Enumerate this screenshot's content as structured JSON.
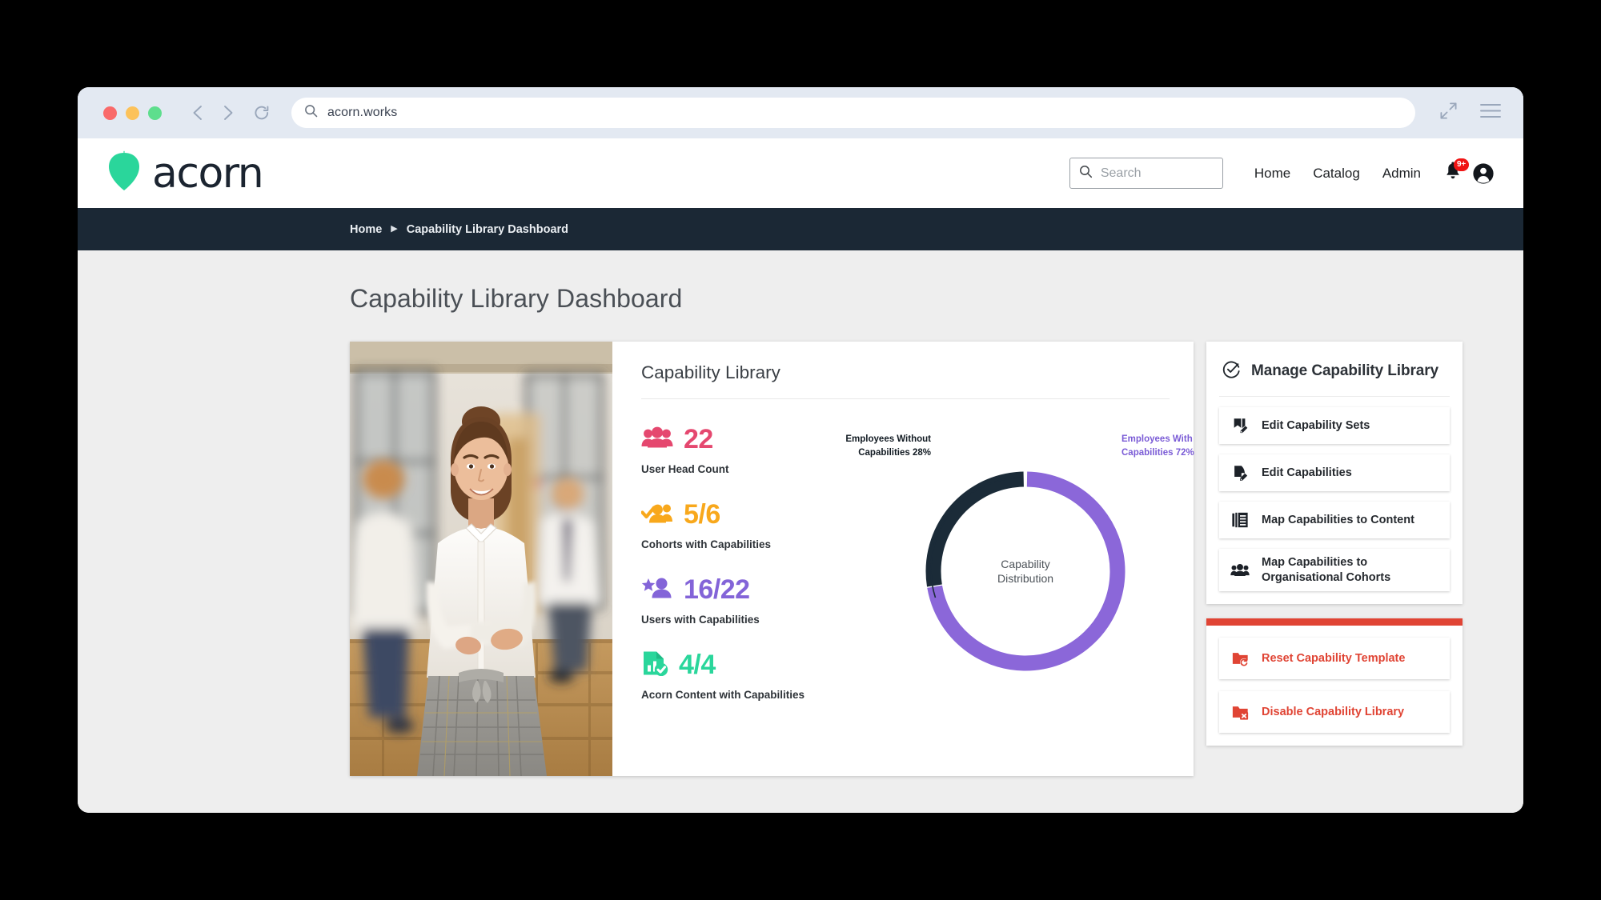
{
  "browser": {
    "url": "acorn.works",
    "back_icon": "chevron-left-icon",
    "forward_icon": "chevron-right-icon",
    "reload_icon": "reload-icon",
    "search_icon": "search-icon",
    "expand_icon": "expand-arrows-icon",
    "menu_icon": "hamburger-menu-icon"
  },
  "header": {
    "logo_text": "acorn",
    "logo_icon": "acorn-leaf-icon",
    "search": {
      "placeholder": "Search",
      "value": "",
      "icon": "search-icon"
    },
    "nav": [
      {
        "label": "Home"
      },
      {
        "label": "Catalog"
      },
      {
        "label": "Admin"
      }
    ],
    "bell_icon": "bell-icon",
    "bell_badge": "9+",
    "avatar_icon": "user-avatar-icon"
  },
  "breadcrumb": {
    "items": [
      {
        "label": "Home"
      },
      {
        "label": "Capability Library Dashboard"
      }
    ],
    "separator": "▶"
  },
  "page": {
    "title": "Capability Library Dashboard"
  },
  "main_card": {
    "title": "Capability Library",
    "photo_alt": "smiling-woman-in-office-photo",
    "stats": [
      {
        "value": "22",
        "label": "User Head Count",
        "icon": "people-group-icon",
        "color": "#e5486f"
      },
      {
        "value": "5/6",
        "label": "Cohorts with Capabilities",
        "icon": "people-check-icon",
        "color": "#f8a81c"
      },
      {
        "value": "16/22",
        "label": "Users with Capabilities",
        "icon": "person-star-icon",
        "color": "#8364d8"
      },
      {
        "value": "4/4",
        "label": "Acorn Content with Capabilities",
        "icon": "document-chart-check-icon",
        "color": "#2ad69b"
      }
    ]
  },
  "chart_data": {
    "type": "pie",
    "title": "Capability Distribution",
    "center_line1": "Capability",
    "center_line2": "Distribution",
    "categories": [
      "Employees With Capabilities",
      "Employees Without Capabilities"
    ],
    "values": [
      72,
      28
    ],
    "unit": "%",
    "labels": [
      {
        "text": "Employees With Capabilities 72%",
        "line1": "Employees With",
        "line2": "Capabilities 72%",
        "color": "#7b5cd6",
        "position": "right"
      },
      {
        "text": "Employees Without Capabilities 28%",
        "line1": "Employees Without",
        "line2": "Capabilities 28%",
        "color": "#111a22",
        "position": "left"
      }
    ],
    "colors": [
      "#8b67d9",
      "#1b2b38"
    ],
    "legend": "labels-outside",
    "grid": false
  },
  "manage_panel": {
    "title": "Manage Capability Library",
    "header_icon": "check-circle-icon",
    "actions": [
      {
        "label": "Edit Capability Sets",
        "icon": "edit-book-icon"
      },
      {
        "label": "Edit Capabilities",
        "icon": "edit-page-icon"
      },
      {
        "label": "Map Capabilities to Content",
        "icon": "content-pages-icon"
      },
      {
        "label": "Map Capabilities to Organisational Cohorts",
        "icon": "people-group-icon"
      }
    ]
  },
  "danger_panel": {
    "accent_color": "#e04434",
    "actions": [
      {
        "label": "Reset Capability Template",
        "icon": "folder-reset-icon"
      },
      {
        "label": "Disable Capability Library",
        "icon": "folder-x-icon"
      }
    ]
  }
}
